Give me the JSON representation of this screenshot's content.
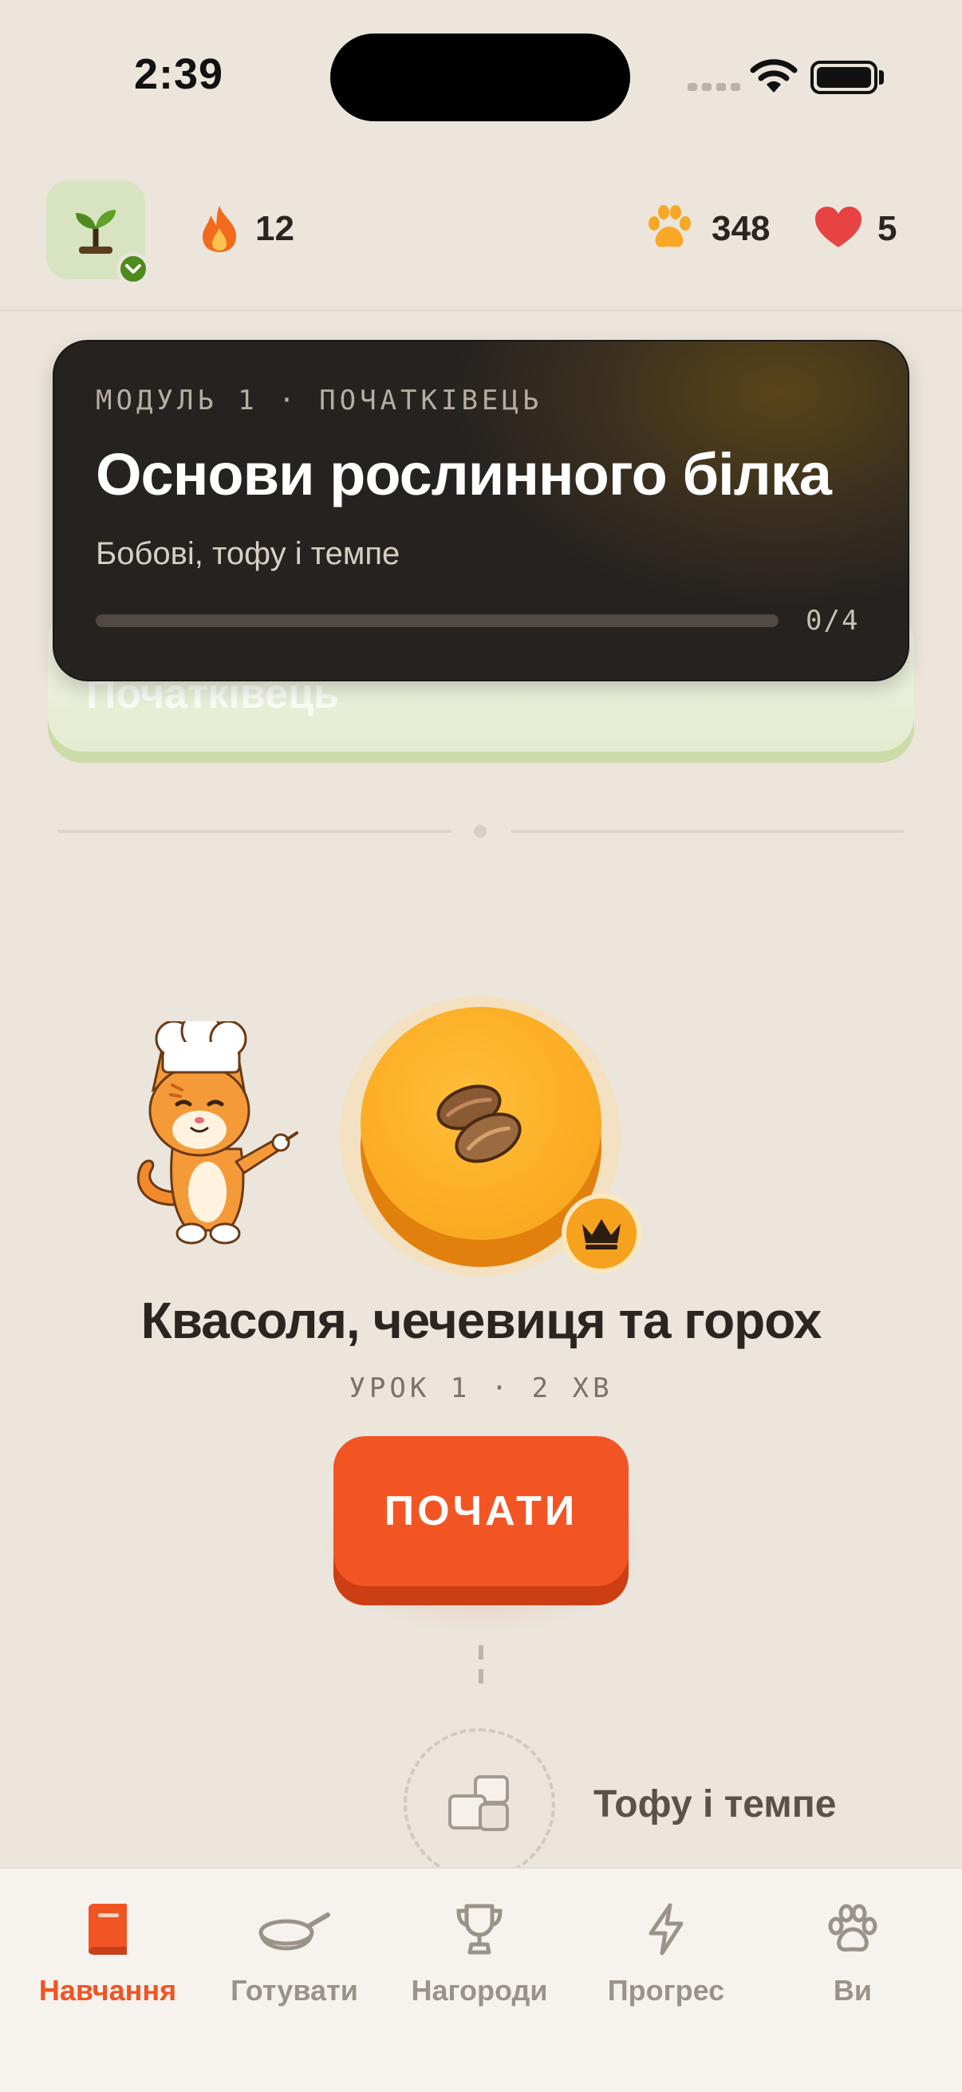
{
  "status_bar": {
    "time": "2:39"
  },
  "header": {
    "streak_count": "12",
    "paws_count": "348",
    "hearts_count": "5",
    "icons": [
      "sprout-icon",
      "flame-icon",
      "paw-icon",
      "heart-icon"
    ]
  },
  "module": {
    "kicker": "МОДУЛЬ 1 · ПОЧАТКІВЕЦЬ",
    "title": "Основи рослинного білка",
    "subtitle": "Бобові, тофу і темпе",
    "progress_text": "0/4",
    "progress_fraction": 0,
    "behind_label": "Початківець"
  },
  "lesson": {
    "title": "Квасоля, чечевиця та горох",
    "meta": "УРОК 1 · 2 ХВ",
    "start_label": "ПОЧАТИ",
    "icon": "beans-icon"
  },
  "next_lesson": {
    "label": "Тофу і темпе",
    "icon": "tofu-icon"
  },
  "tabs": [
    {
      "label": "Навчання",
      "icon": "book-icon",
      "active": true
    },
    {
      "label": "Готувати",
      "icon": "pan-icon",
      "active": false
    },
    {
      "label": "Нагороди",
      "icon": "trophy-icon",
      "active": false
    },
    {
      "label": "Прогрес",
      "icon": "bolt-icon",
      "active": false
    },
    {
      "label": "Ви",
      "icon": "paw-icon",
      "active": false
    }
  ],
  "colors": {
    "accent": "#f25523",
    "background": "#ebe5dc",
    "node": "#fbad24"
  }
}
